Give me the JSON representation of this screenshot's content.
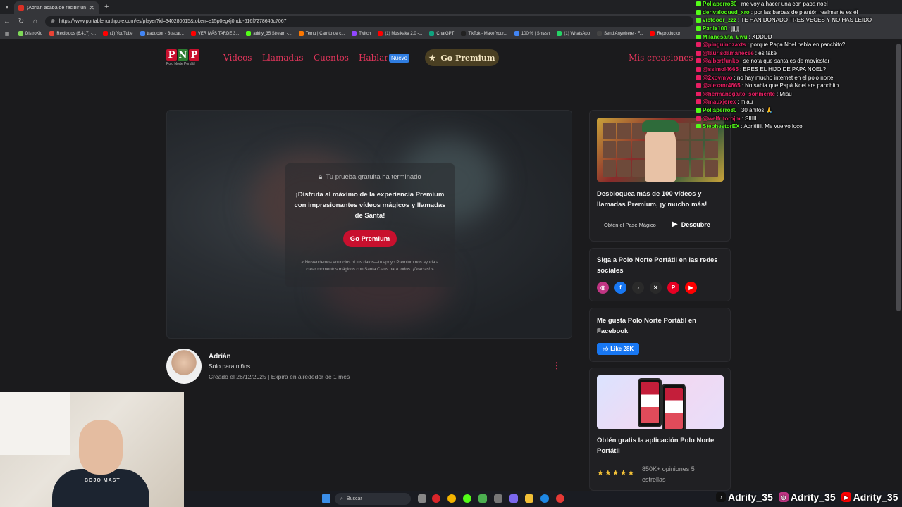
{
  "browser": {
    "tab_title": "¡Adrián acaba de recibir un vi",
    "url": "https://www.portablenorthpole.com/es/player?id=340280015&token=e15p0eg4j0ndo-616f7278646c7067",
    "bookmarks": [
      {
        "label": "DistroKid",
        "color": "#7ed957"
      },
      {
        "label": "Recibidos (6.417) -...",
        "color": "#ea4335"
      },
      {
        "label": "(1) YouTube",
        "color": "#ff0000"
      },
      {
        "label": "traductor - Buscar...",
        "color": "#4285f4"
      },
      {
        "label": "VER MÁS TARDE 3...",
        "color": "#ff0000"
      },
      {
        "label": "adrity_35 Stream -...",
        "color": "#53fc18"
      },
      {
        "label": "Temu | Carrito de c...",
        "color": "#fb7701"
      },
      {
        "label": "Twitch",
        "color": "#9146ff"
      },
      {
        "label": "(1) Musikaka 2.0 -...",
        "color": "#ff0000"
      },
      {
        "label": "ChatGPT",
        "color": "#10a37f"
      },
      {
        "label": "TikTok - Make Your...",
        "color": "#222222"
      },
      {
        "label": "100 % | Smash",
        "color": "#4285f4"
      },
      {
        "label": "(1) WhatsApp",
        "color": "#25d366"
      },
      {
        "label": "Send Anywhere - F...",
        "color": "#444444"
      },
      {
        "label": "Reproductor",
        "color": "#ff0000"
      }
    ]
  },
  "site": {
    "logo_letters": [
      "P",
      "N",
      "P"
    ],
    "logo_subtitle": "Polo Norte Portátil",
    "nav": {
      "videos": "Videos",
      "llamadas": "Llamadas",
      "cuentos": "Cuentos",
      "hablar": "Hablar",
      "nuevo_badge": "Nuevo",
      "go_premium": "Go Premium",
      "mis_creaciones": "Mis creaciones"
    },
    "accent_color": "#e0355a"
  },
  "player": {
    "trial_ended": "Tu prueba gratuita ha terminado",
    "headline": "¡Disfruta al máximo de la experiencia Premium con impresionantes vídeos mágicos y llamadas de Santa!",
    "cta": "Go Premium",
    "note": "« No vendemos anuncios ni tus datos—tu apoyo Premium nos ayuda a crear momentos mágicos con Santa Claus para todos. ¡Gracias! »"
  },
  "author": {
    "name": "Adrián",
    "audience": "Solo para niños",
    "meta": "Creado el 26/12/2025 | Expira en alrededor de 1 mes"
  },
  "sidebar": {
    "promo": {
      "title": "Desbloquea más de 100 vídeos y llamadas Premium, ¡y mucho más!",
      "pass_link": "Obtén el Pase Mágico",
      "discover": "Descubre"
    },
    "social": {
      "title": "Siga a Polo Norte Portátil en las redes sociales",
      "icons": [
        {
          "name": "instagram-icon",
          "glyph": "◎",
          "color": "#c13584"
        },
        {
          "name": "facebook-icon",
          "glyph": "f",
          "color": "#1877f2"
        },
        {
          "name": "tiktok-icon",
          "glyph": "♪",
          "color": "#2a2a2a"
        },
        {
          "name": "x-icon",
          "glyph": "✕",
          "color": "#2a2a2a"
        },
        {
          "name": "pinterest-icon",
          "glyph": "P",
          "color": "#e60023"
        },
        {
          "name": "youtube-icon",
          "glyph": "▶",
          "color": "#ff0000"
        }
      ]
    },
    "facebook": {
      "title": "Me gusta Polo Norte Portátil en Facebook",
      "like_label": "Like 28K"
    },
    "app": {
      "title": "Obtén gratis la aplicación Polo Norte Portátil",
      "stars": "★★★★★",
      "ratings": "850K+ opiniones 5 estrellas"
    }
  },
  "chat": [
    {
      "user": "Pollaperro80",
      "text": ": me voy a hacer una con papa noel",
      "color": "#53fc18"
    },
    {
      "user": "derivaloqued_xro",
      "text": ": por las barbas de plantón realmente es él",
      "color": "#53fc18"
    },
    {
      "user": "victooor_zzz",
      "text": ": TE HAN DONADO TRES VECES Y NO HAS LEIDO",
      "color": "#53fc18"
    },
    {
      "user": "Panix100",
      "text": ": jjjjjj",
      "color": "#53fc18"
    },
    {
      "user": "Milanesaita_uwu",
      "text": ": XDDDD",
      "color": "#53fc18"
    },
    {
      "user": "@pinguinozaxts",
      "text": ": porque Papa Noel habla en panchito?",
      "color": "#e91e63"
    },
    {
      "user": "@laurisdamanecee",
      "text": ": es fake",
      "color": "#e91e63"
    },
    {
      "user": "@albertfunko",
      "text": ": se nota que santa es de moviestar",
      "color": "#e91e63"
    },
    {
      "user": "@ssimol4665",
      "text": ": ERES EL HIJO DE PAPA NOEL?",
      "color": "#e91e63"
    },
    {
      "user": "@2xovmyo",
      "text": ": no hay mucho internet en el polo norte",
      "color": "#e91e63"
    },
    {
      "user": "@alexanr4665",
      "text": ": No sabia que Papá Noel era panchito",
      "color": "#e91e63"
    },
    {
      "user": "@hermanogaito_sonmente",
      "text": ": Miau",
      "color": "#e91e63"
    },
    {
      "user": "@mauxjerex",
      "text": ": miau",
      "color": "#e91e63"
    },
    {
      "user": "Pollaperro80",
      "text": ": 30 añitos 🙏",
      "color": "#53fc18"
    },
    {
      "user": "@welfritorojm",
      "text": ": SIIIII",
      "color": "#e91e63"
    },
    {
      "user": "StephestorEX",
      "text": ": Adritiiiii. Me vuelvo loco",
      "color": "#53fc18"
    }
  ],
  "webcam": {
    "shirt_text": "BOJO MAST"
  },
  "taskbar": {
    "search_placeholder": "Buscar",
    "handles": [
      {
        "name": "tiktok-handle",
        "label": "Adrity_35",
        "color": "#111111",
        "glyph": "♪"
      },
      {
        "name": "instagram-handle",
        "label": "Adrity_35",
        "color": "#c13584",
        "glyph": "◎"
      },
      {
        "name": "youtube-handle",
        "label": "Adrity_35",
        "color": "#ff0000",
        "glyph": "▶"
      }
    ]
  }
}
